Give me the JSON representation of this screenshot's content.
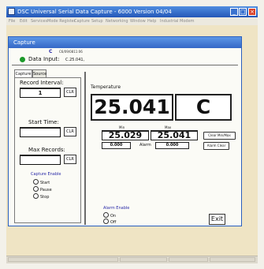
{
  "app": {
    "title": "DSC   Universal Serial Data Capture  -  6000   Version 04/04",
    "menu": [
      "File",
      "Edit",
      "Services",
      "Mode Register",
      "Capture",
      "Setup",
      "Networking",
      "Window",
      "Help",
      "Industrial Modem"
    ]
  },
  "capture_window": {
    "title": "Capture",
    "c_label": "C",
    "timestamp": "C6/09/0811:06",
    "data_input_label": "Data Input:",
    "data_input_value": "C.25.041,"
  },
  "tabs": [
    "Capture",
    "Source"
  ],
  "left_panel": {
    "record_interval_label": "Record Interval:",
    "record_interval_value": "1",
    "start_time_label": "Start Time:",
    "start_time_value": "",
    "max_records_label": "Max Records:",
    "max_records_value": "",
    "clr_label": "CLR",
    "capture_enable_label": "Capture Enable",
    "capture_options": [
      "Start",
      "Pause",
      "Stop"
    ]
  },
  "readout": {
    "label": "Temperature",
    "value": "25.041",
    "unit": "C",
    "min_label": "Min",
    "max_label": "Max",
    "min_value": "25.029",
    "max_value": "25.041",
    "clear_minmax_label": "Clear Min/Max",
    "alarm_low": "0.000",
    "alarm_label": "Alarm",
    "alarm_high": "0.000",
    "alarm_clear_label": "Alarm Clear"
  },
  "alarm_enable": {
    "label": "Alarm Enable",
    "options": [
      "On",
      "Off"
    ]
  },
  "exit_label": "Exit"
}
